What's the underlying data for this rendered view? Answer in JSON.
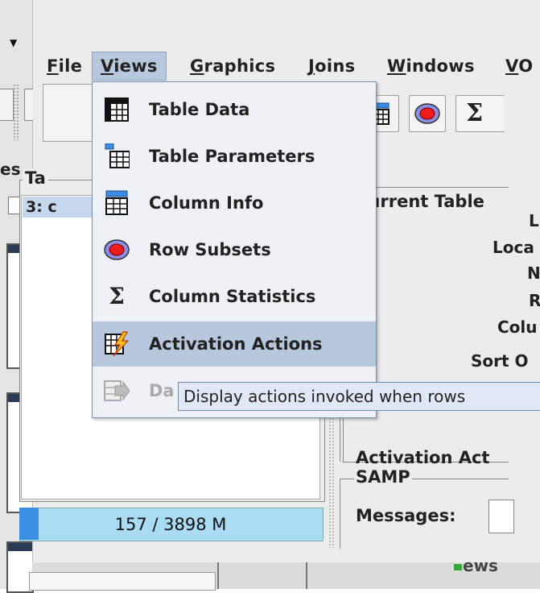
{
  "menubar": {
    "items": [
      {
        "label": "File",
        "acc": "F",
        "rest": "ile"
      },
      {
        "label": "Views",
        "acc": "V",
        "rest": "iews"
      },
      {
        "label": "Graphics",
        "acc": "G",
        "rest": "raphics"
      },
      {
        "label": "Joins",
        "acc": "J",
        "rest": "oins"
      },
      {
        "label": "Windows",
        "acc": "W",
        "rest": "indows"
      },
      {
        "label": "VO",
        "acc": "V",
        "rest": "O"
      }
    ]
  },
  "views_menu": {
    "items": [
      {
        "label": "Table Data",
        "icon": "table-data-icon",
        "state": "normal"
      },
      {
        "label": "Table Parameters",
        "icon": "table-parameters-icon",
        "state": "normal"
      },
      {
        "label": "Column Info",
        "icon": "column-info-icon",
        "state": "normal"
      },
      {
        "label": "Row Subsets",
        "icon": "row-subsets-icon",
        "state": "normal"
      },
      {
        "label": "Column Statistics",
        "icon": "sigma-icon",
        "state": "normal"
      },
      {
        "label": "Activation Actions",
        "icon": "activation-actions-icon",
        "state": "highlighted"
      },
      {
        "label": "Da",
        "icon": "table-arrow-icon",
        "state": "disabled"
      }
    ]
  },
  "tooltip": {
    "text": "Display actions invoked when rows"
  },
  "toolbar": {
    "sigma_label": "Σ"
  },
  "table_list": {
    "title": "Ta",
    "selected_row": "3: c"
  },
  "memory": {
    "text": "157 / 3898 M",
    "used_fraction": 0.04
  },
  "current_table": {
    "title": "Current Table",
    "props": [
      "L",
      "Loca",
      "N",
      "R",
      "Colu",
      "Sort O"
    ],
    "activation_label": "Activation Act"
  },
  "samp": {
    "title": "SAMP",
    "messages_label": "Messages:"
  },
  "left_edge": {
    "label": "es"
  },
  "background": {
    "bottom_label": "ews"
  },
  "colors": {
    "highlight": "#b7c8dc",
    "menu_bg": "#eef1f6",
    "memory_bar": "#a9dcf2",
    "selected_row": "#c5d7ea"
  }
}
